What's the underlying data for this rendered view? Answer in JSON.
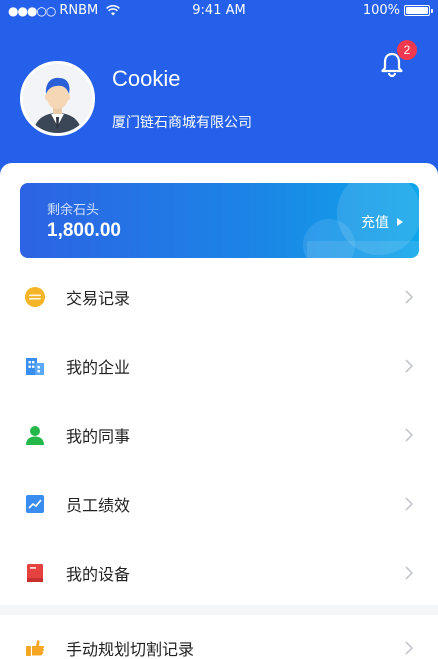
{
  "status_bar": {
    "carrier": "RNBM",
    "time": "9:41 AM",
    "battery": "100%"
  },
  "profile": {
    "name": "Cookie",
    "company": "厦门链石商城有限公司"
  },
  "notifications": {
    "count": "2"
  },
  "balance": {
    "label": "剩余石头",
    "value": "1,800.00",
    "action_label": "充值"
  },
  "menu": [
    {
      "label": "交易记录",
      "icon": "coin-icon"
    },
    {
      "label": "我的企业",
      "icon": "building-icon"
    },
    {
      "label": "我的同事",
      "icon": "person-icon"
    },
    {
      "label": "员工绩效",
      "icon": "chart-icon"
    },
    {
      "label": "我的设备",
      "icon": "device-icon"
    },
    {
      "label": "手动规划切割记录",
      "icon": "hand-point-icon"
    }
  ],
  "colors": {
    "header": "#2460e9",
    "badge": "#f0384f",
    "coin": "#f5b425",
    "building": "#3a8df0",
    "person": "#24b84a",
    "chart": "#3a8df0",
    "device": "#e5423f",
    "hand": "#f5a623"
  }
}
